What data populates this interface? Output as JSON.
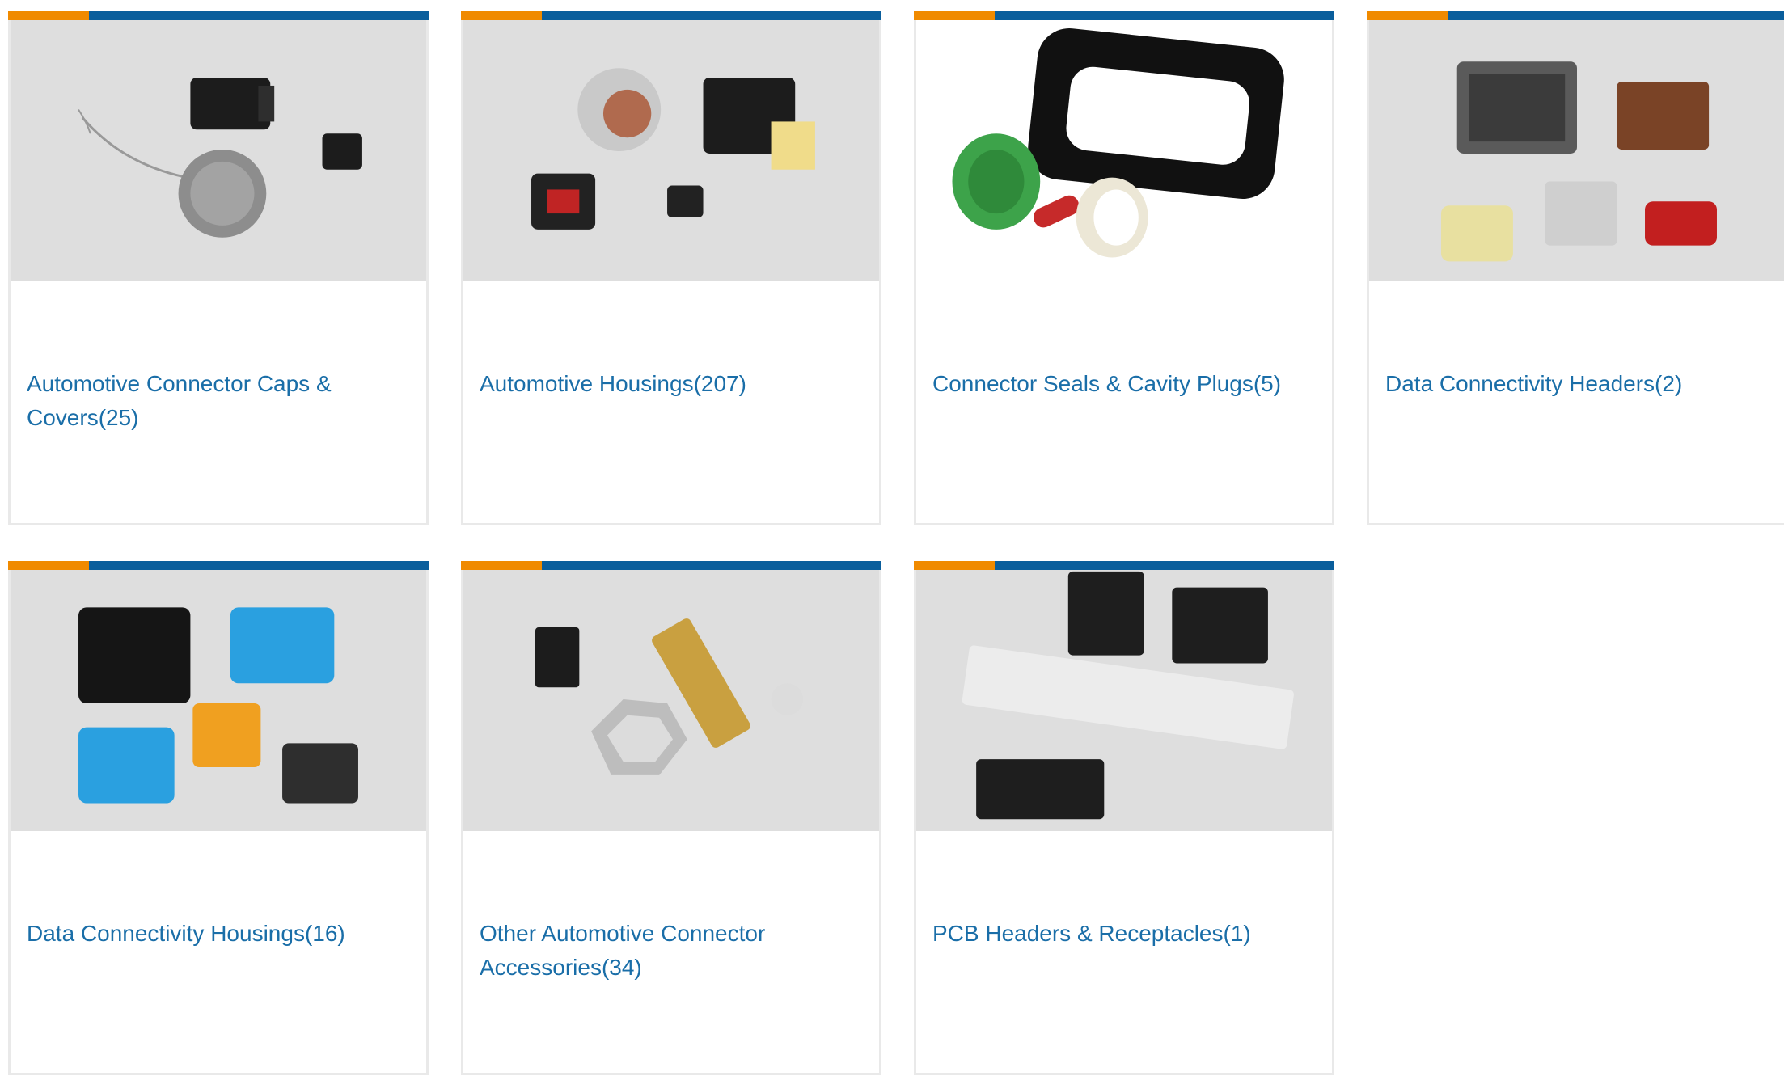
{
  "categories": [
    {
      "name": "Automotive Connector Caps & Covers",
      "count": "(25)",
      "image_icon": "caps-covers-image"
    },
    {
      "name": "Automotive Housings",
      "count": "(207)",
      "image_icon": "housings-image"
    },
    {
      "name": "Connector Seals & Cavity Plugs",
      "count": "(5)",
      "image_icon": "seals-plugs-image"
    },
    {
      "name": "Data Connectivity Headers",
      "count": "(2)",
      "image_icon": "data-headers-image"
    },
    {
      "name": "Data Connectivity Housings",
      "count": "(16)",
      "image_icon": "data-housings-image"
    },
    {
      "name": "Other Automotive Connector Accessories",
      "count": "(34)",
      "image_icon": "accessories-image"
    },
    {
      "name": "PCB Headers & Receptacles",
      "count": "(1)",
      "image_icon": "pcb-headers-image"
    }
  ],
  "colors": {
    "accent_orange": "#f08a00",
    "accent_blue": "#0a5e9c",
    "link": "#1a6ea8",
    "border": "#e9e9e9"
  }
}
